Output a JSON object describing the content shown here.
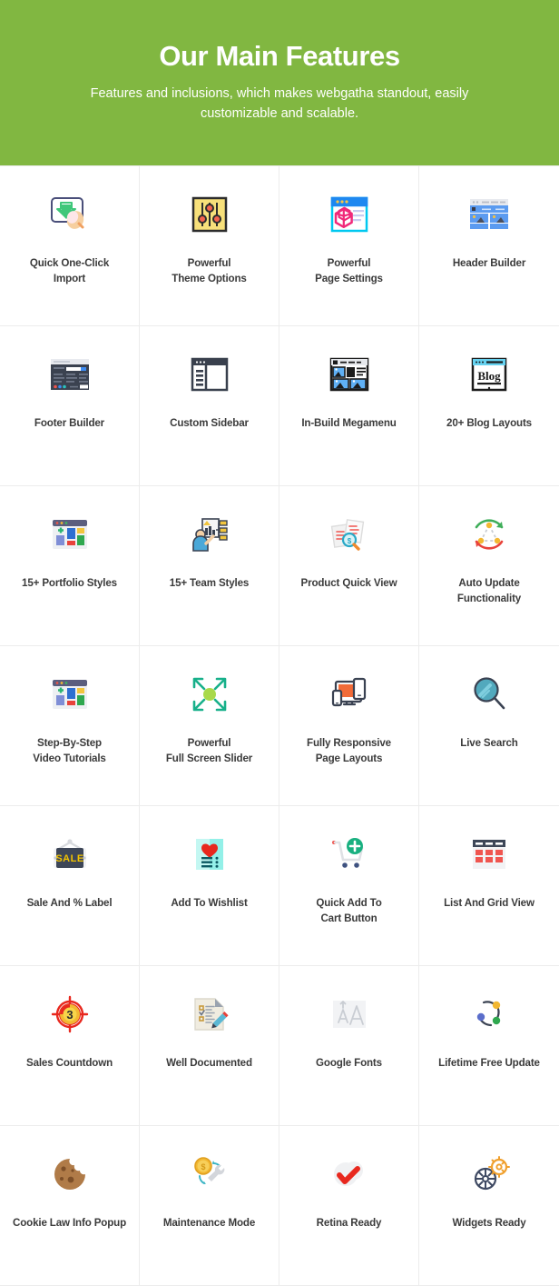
{
  "hero": {
    "title": "Our Main Features",
    "subtitle": "Features and inclusions, which makes webgatha standout, easily customizable and scalable.",
    "background_color": "#81b741",
    "text_color": "#ffffff"
  },
  "grid": {
    "columns": 4,
    "rows": 7,
    "divider_color": "#ececec",
    "label_color": "#3b3b3b",
    "features": [
      {
        "label": "Quick One-Click\nImport",
        "icon": "one-click-import-icon"
      },
      {
        "label": "Powerful\nTheme Options",
        "icon": "theme-options-sliders-icon"
      },
      {
        "label": "Powerful\nPage Settings",
        "icon": "page-settings-box-icon"
      },
      {
        "label": "Header Builder",
        "icon": "header-builder-icon"
      },
      {
        "label": "Footer Builder",
        "icon": "footer-builder-icon"
      },
      {
        "label": "Custom Sidebar",
        "icon": "custom-sidebar-icon"
      },
      {
        "label": "In-Build Megamenu",
        "icon": "megamenu-icon"
      },
      {
        "label": "20+ Blog Layouts",
        "icon": "blog-layouts-icon"
      },
      {
        "label": "15+ Portfolio Styles",
        "icon": "portfolio-styles-icon"
      },
      {
        "label": "15+ Team Styles",
        "icon": "team-styles-icon"
      },
      {
        "label": "Product Quick View",
        "icon": "product-quick-view-icon"
      },
      {
        "label": "Auto Update\nFunctionality",
        "icon": "auto-update-icon"
      },
      {
        "label": "Step-By-Step\nVideo Tutorials",
        "icon": "video-tutorials-icon"
      },
      {
        "label": "Powerful\nFull Screen Slider",
        "icon": "full-screen-slider-icon"
      },
      {
        "label": "Fully Responsive\nPage Layouts",
        "icon": "responsive-layouts-icon"
      },
      {
        "label": "Live Search",
        "icon": "live-search-magnifier-icon"
      },
      {
        "label": "Sale And % Label",
        "icon": "sale-label-icon"
      },
      {
        "label": "Add To Wishlist",
        "icon": "wishlist-heart-icon"
      },
      {
        "label": "Quick Add To\nCart Button",
        "icon": "add-to-cart-icon"
      },
      {
        "label": "List And Grid View",
        "icon": "list-grid-view-icon"
      },
      {
        "label": "Sales Countdown",
        "icon": "sales-countdown-icon"
      },
      {
        "label": "Well Documented",
        "icon": "well-documented-icon"
      },
      {
        "label": "Google Fonts",
        "icon": "google-fonts-icon"
      },
      {
        "label": "Lifetime Free Update",
        "icon": "lifetime-free-update-icon"
      },
      {
        "label": "Cookie Law Info Popup",
        "icon": "cookie-icon"
      },
      {
        "label": "Maintenance Mode",
        "icon": "maintenance-mode-icon"
      },
      {
        "label": "Retina Ready",
        "icon": "retina-ready-check-icon"
      },
      {
        "label": "Widgets Ready",
        "icon": "widgets-ready-gears-icon"
      }
    ]
  }
}
